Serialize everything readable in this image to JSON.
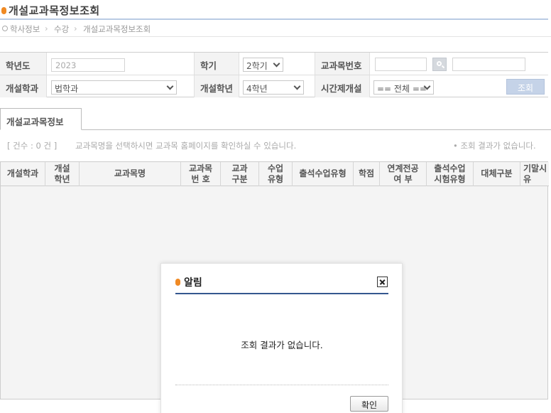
{
  "page": {
    "title": "개설교과목정보조회"
  },
  "breadcrumb": {
    "items": [
      "학사정보",
      "수강",
      "개설교과목정보조회"
    ],
    "separator": "›"
  },
  "search_form": {
    "year": {
      "label": "학년도",
      "value": "2023"
    },
    "semester": {
      "label": "학기",
      "value": "2학기"
    },
    "course_number": {
      "label": "교과목번호",
      "value": "",
      "name_value": ""
    },
    "department": {
      "label": "개설학과",
      "value": "법학과"
    },
    "grade": {
      "label": "개설학년",
      "value": "4학년"
    },
    "timetable": {
      "label": "시간제개설",
      "value": "== 전체 =="
    },
    "query_button": "조회"
  },
  "tabs": [
    {
      "label": "개설교과목정보",
      "selected": true
    }
  ],
  "info": {
    "count_text": "[ 건수 : 0 건 ]",
    "hint": "교과목명을 선택하시면 교과목 홈페이지를 확인하실 수 있습니다.",
    "result_text": "• 조회 결과가 없습니다."
  },
  "grid": {
    "columns": [
      [
        "개설학과"
      ],
      [
        "개설",
        "학년"
      ],
      [
        "교과목명"
      ],
      [
        "교과목",
        "번    호"
      ],
      [
        "교과",
        "구분"
      ],
      [
        "수업",
        "유형"
      ],
      [
        "출석수업유형"
      ],
      [
        "학점"
      ],
      [
        "연계전공",
        "여      부"
      ],
      [
        "출석수업",
        "시험유형"
      ],
      [
        "대체구분"
      ],
      [
        "기말시",
        "유"
      ]
    ],
    "rows": []
  },
  "dialog": {
    "title": "알림",
    "message": "조회 결과가 없습니다.",
    "ok_label": "확인"
  },
  "colors": {
    "accent_orange": "#f08a24",
    "dialog_rule": "#35578f",
    "title_rule": "#b9cbe4",
    "query_button": "#c5d3e8"
  }
}
